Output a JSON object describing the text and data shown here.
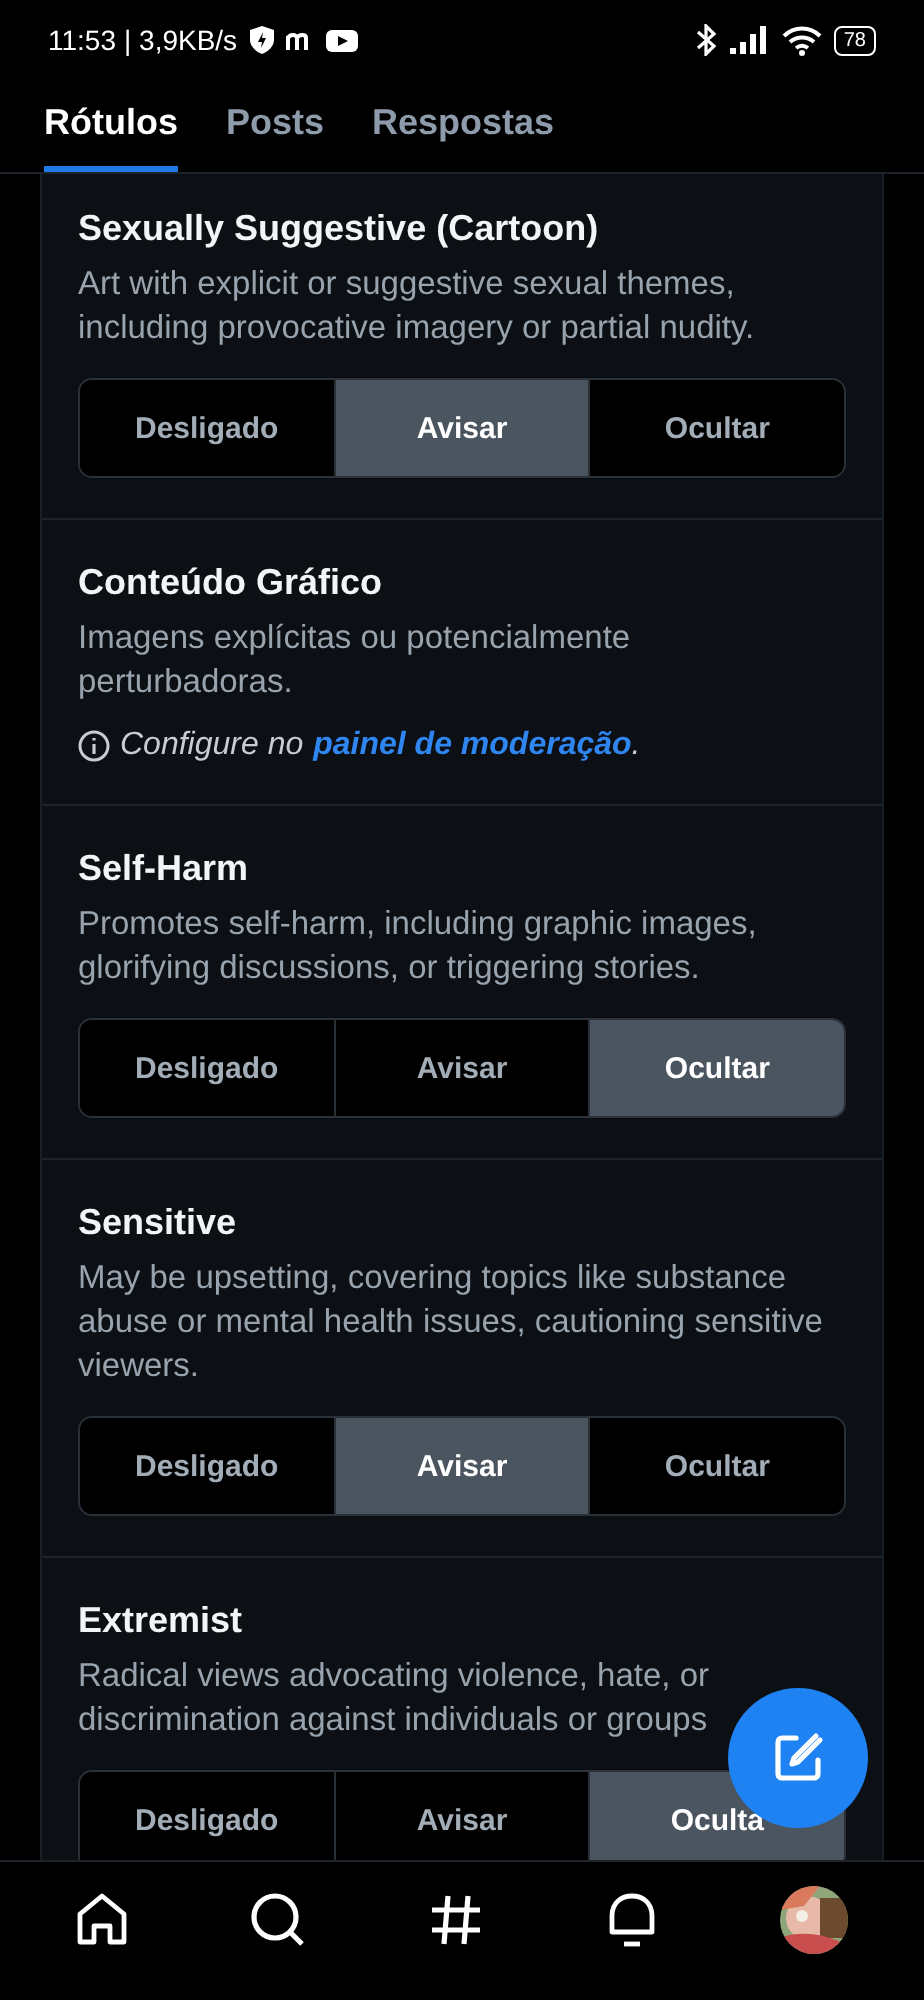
{
  "status_bar": {
    "time": "11:53",
    "speed": "| 3,9KB/s",
    "battery": "78"
  },
  "tabs": [
    {
      "label": "Rótulos",
      "selected": true
    },
    {
      "label": "Posts",
      "selected": false
    },
    {
      "label": "Respostas",
      "selected": false
    }
  ],
  "sections": [
    {
      "kind": "segmented",
      "title": "Sexually Suggestive (Cartoon)",
      "description": "Art with explicit or suggestive sexual themes, including provocative imagery or partial nudity.",
      "options": [
        {
          "label": "Desligado",
          "selected": false
        },
        {
          "label": "Avisar",
          "selected": true
        },
        {
          "label": "Ocultar",
          "selected": false
        }
      ]
    },
    {
      "kind": "link",
      "title": "Conteúdo Gráfico",
      "description": "Imagens explícitas ou potencialmente perturbadoras.",
      "note": "*Configure no*",
      "link": "*painel de moderação*",
      "suffix": "*.*"
    },
    {
      "kind": "segmented",
      "title": "Self-Harm",
      "description": "Promotes self-harm, including graphic images, glorifying discussions, or triggering stories.",
      "options": [
        {
          "label": "Desligado",
          "selected": false
        },
        {
          "label": "Avisar",
          "selected": false
        },
        {
          "label": "Ocultar",
          "selected": true
        }
      ]
    },
    {
      "kind": "segmented",
      "title": "Sensitive",
      "description": "May be upsetting, covering topics like substance abuse or mental health issues, cautioning sensitive viewers.",
      "options": [
        {
          "label": "Desligado",
          "selected": false
        },
        {
          "label": "Avisar",
          "selected": true
        },
        {
          "label": "Ocultar",
          "selected": false
        }
      ]
    },
    {
      "kind": "segmented",
      "title": "Extremist",
      "description": "Radical views advocating violence, hate, or discrimination against individuals or groups",
      "options": [
        {
          "label": "Desligado",
          "selected": false
        },
        {
          "label": "Avisar",
          "selected": false
        },
        {
          "label": "Oculta",
          "selected": true
        }
      ]
    }
  ]
}
